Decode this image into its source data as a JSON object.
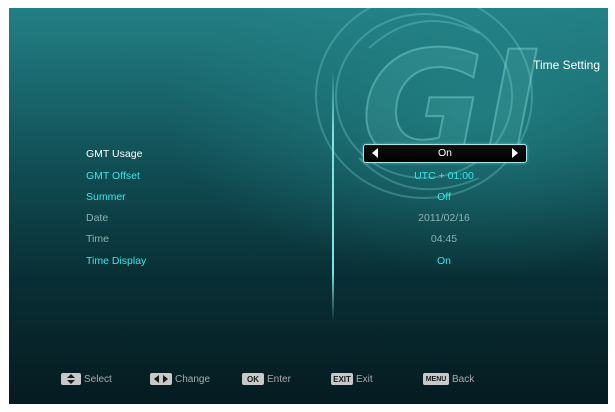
{
  "header": {
    "title": "Time Setting"
  },
  "settings": [
    {
      "label": "GMT Usage",
      "value": "On"
    },
    {
      "label": "GMT Offset",
      "value": "UTC + 01:00"
    },
    {
      "label": "Summer",
      "value": "Off"
    },
    {
      "label": "Date",
      "value": "2011/02/16"
    },
    {
      "label": "Time",
      "value": "04:45"
    },
    {
      "label": "Time Display",
      "value": "On"
    }
  ],
  "footer": {
    "select_label": "Select",
    "change_label": "Change",
    "enter_key": "OK",
    "enter_label": "Enter",
    "exit_key": "EXIT",
    "exit_label": "Exit",
    "menu_key": "MENU",
    "back_label": "Back"
  },
  "logo": {
    "text": "GI"
  },
  "colors": {
    "selected_label": "#ffffff",
    "active": "#39e8e8",
    "disabled": "#8fb1b3",
    "divider": "#7fe4df"
  }
}
